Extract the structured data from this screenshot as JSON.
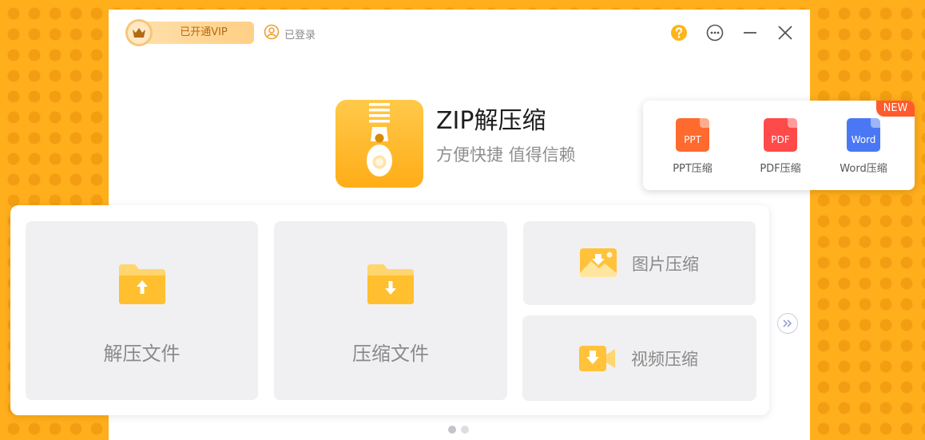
{
  "header": {
    "vip_label": "已开通VIP",
    "login_label": "已登录",
    "icons": [
      "crown-icon",
      "user-icon",
      "help-icon",
      "more-icon",
      "minimize-icon",
      "close-icon"
    ]
  },
  "hero": {
    "title": "ZIP解压缩",
    "subtitle": "方便快捷 值得信赖"
  },
  "doc_panel": {
    "badge": "NEW",
    "items": [
      {
        "icon_text": "PPT",
        "label": "PPT压缩",
        "color": "#ff6a2e"
      },
      {
        "icon_text": "PDF",
        "label": "PDF压缩",
        "color": "#ff4a4a"
      },
      {
        "icon_text": "Word",
        "label": "Word压缩",
        "color": "#4a78f5"
      }
    ]
  },
  "tools": {
    "extract": "解压文件",
    "compress": "压缩文件",
    "image": "图片压缩",
    "video": "视频压缩"
  },
  "pager": {
    "pages": 2,
    "current": 1
  },
  "colors": {
    "accent": "#ffae1c",
    "tile_bg": "#f0f0f2",
    "icon_yellow": "#ffc23a",
    "vip_text": "#b26a14"
  }
}
